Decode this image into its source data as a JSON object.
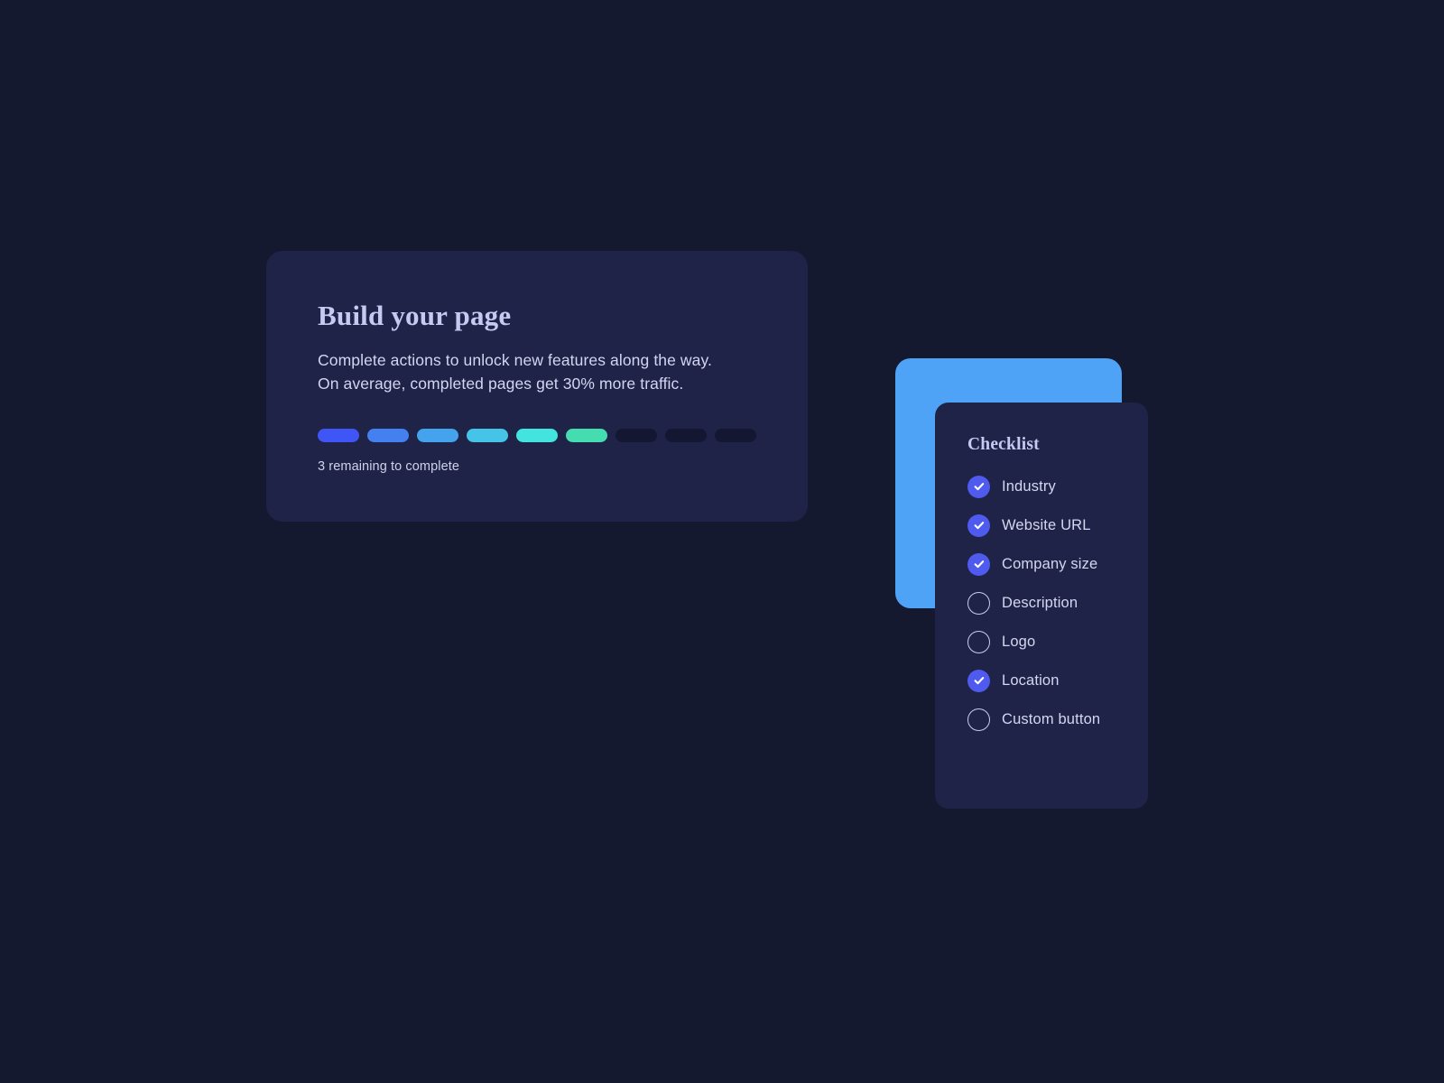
{
  "theme": {
    "page_background": "#151930",
    "card_background": "#1F2348",
    "accent_blue": "#4EA3F7",
    "accent_indigo": "#4F5AEF",
    "heading_color": "#C6C9F2",
    "body_color": "#D2D6F0",
    "segment_inactive": "#131731"
  },
  "build_card": {
    "title": "Build your page",
    "description_line_1": "Complete actions to unlock new features along the way.",
    "description_line_2": "On average, completed pages get 30% more traffic.",
    "progress_caption": "3 remaining to complete",
    "progress": {
      "total_segments": 9,
      "completed_segments": 6,
      "remaining_segments": 3,
      "segment_colors": [
        "#4055F5",
        "#4480F0",
        "#45A2EC",
        "#45C4E8",
        "#43E3E0",
        "#45DDB0"
      ],
      "inactive_color": "#131731"
    }
  },
  "checklist_card": {
    "title": "Checklist",
    "items": [
      {
        "label": "Industry",
        "checked": true,
        "icon": "check-icon"
      },
      {
        "label": "Website URL",
        "checked": true,
        "icon": "check-icon"
      },
      {
        "label": "Company size",
        "checked": true,
        "icon": "check-icon"
      },
      {
        "label": "Description",
        "checked": false,
        "icon": "empty-circle-icon"
      },
      {
        "label": "Logo",
        "checked": false,
        "icon": "empty-circle-icon"
      },
      {
        "label": "Location",
        "checked": true,
        "icon": "check-icon"
      },
      {
        "label": "Custom button",
        "checked": false,
        "icon": "empty-circle-icon"
      }
    ]
  }
}
